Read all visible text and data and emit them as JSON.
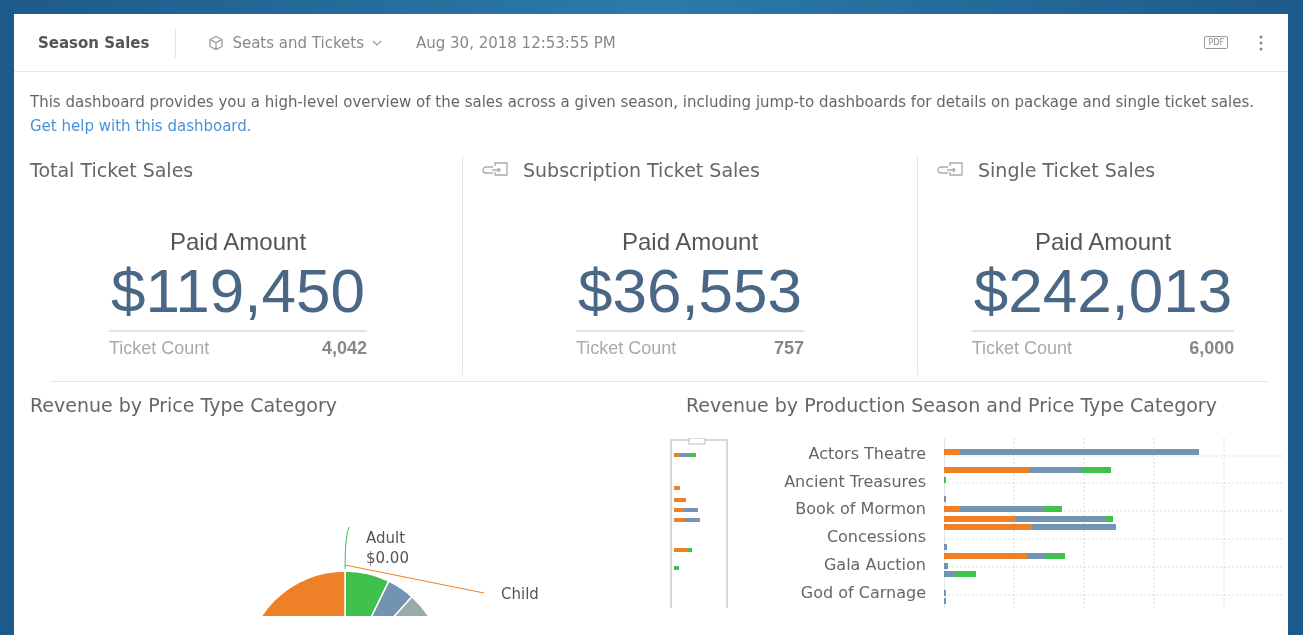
{
  "header": {
    "title": "Season Sales",
    "source": "Seats and Tickets",
    "timestamp": "Aug 30, 2018 12:53:55 PM",
    "export_label": "PDF"
  },
  "description": {
    "text": "This dashboard provides you a high-level overview of the sales across a given season, including jump-to dashboards for details on package and single ticket sales.",
    "link": "Get help with this dashboard."
  },
  "kpis": [
    {
      "title": "Total Ticket Sales",
      "jump_link": false,
      "label": "Paid Amount",
      "value": "$119,450",
      "count_label": "Ticket Count",
      "count": "4,042"
    },
    {
      "title": "Subscription Ticket Sales",
      "jump_link": true,
      "label": "Paid Amount",
      "value": "$36,553",
      "count_label": "Ticket Count",
      "count": "757"
    },
    {
      "title": "Single Ticket Sales",
      "jump_link": true,
      "label": "Paid Amount",
      "value": "$242,013",
      "count_label": "Ticket Count",
      "count": "6,000"
    }
  ],
  "pie_chart": {
    "title": "Revenue by Price Type Category",
    "labels": [
      {
        "name": "Adult",
        "value": "$0.00"
      },
      {
        "name": "Child"
      }
    ]
  },
  "bar_chart": {
    "title": "Revenue by Production Season and Price Type Category",
    "categories": [
      "Actors Theatre",
      "Ancient Treasures",
      "Book of Mormon",
      "Concessions",
      "Gala Auction",
      "God of Carnage"
    ]
  }
}
